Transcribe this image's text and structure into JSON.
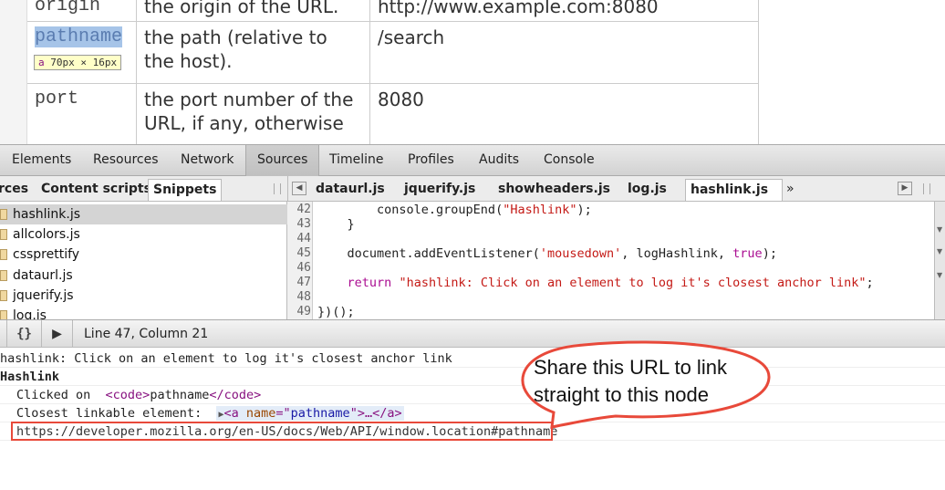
{
  "page": {
    "rows": [
      {
        "name": "origin",
        "desc": "the origin of the URL.",
        "example": "http://www.example.com:8080"
      },
      {
        "name": "pathname",
        "desc": "the path (relative to the host).",
        "example": "/search"
      },
      {
        "name": "port",
        "desc": "the port number of the URL, if any, otherwise",
        "example": "8080"
      }
    ],
    "tooltip": {
      "tag": "a",
      "dims": "70px × 16px"
    }
  },
  "devtools": {
    "tabs": [
      "Elements",
      "Resources",
      "Network",
      "Sources",
      "Timeline",
      "Profiles",
      "Audits",
      "Console"
    ],
    "selected_tab": "Sources",
    "nav_tabs": [
      "rces",
      "Content scripts",
      "Snippets"
    ],
    "files": [
      "hashlink.js",
      "allcolors.js",
      "cssprettify",
      "dataurl.js",
      "jquerify.js",
      "log.js"
    ],
    "editor_tabs": [
      "dataurl.js",
      "jquerify.js",
      "showheaders.js",
      "log.js",
      "hashlink.js"
    ],
    "more_tabs": "»",
    "line_numbers": [
      "42",
      "43",
      "44",
      "45",
      "46",
      "47",
      "48",
      "49"
    ],
    "code": {
      "l42a": "        console.groupEnd(",
      "l42b": "\"Hashlink\"",
      "l42c": ");",
      "l43": "    }",
      "l45a": "    document.addEventListener(",
      "l45b": "'mousedown'",
      "l45c": ", logHashlink, ",
      "l45d": "true",
      "l45e": ");",
      "l47a": "    ",
      "l47b": "return",
      "l47c": " ",
      "l47d": "\"hashlink: Click on an element to log it's closest anchor link\"",
      "l47e": ";",
      "l49": "})();"
    },
    "status": {
      "pretty_print": "{}",
      "position": "Line 47, Column 21"
    },
    "console": {
      "line1": "hashlink: Click on an element to log it's closest anchor link",
      "group": "Hashlink",
      "clicked_label": "Clicked on  ",
      "clicked_open": "<code>",
      "clicked_text": "pathname",
      "clicked_close": "</code>",
      "closest_label": "Closest linkable element:  ",
      "el_open": "<a ",
      "el_attr": "name",
      "el_eq": "=\"",
      "el_val": "pathname",
      "el_end": "\">…</a>",
      "url": "https://developer.mozilla.org/en-US/docs/Web/API/window.location#pathname"
    }
  },
  "callout": {
    "line1": "Share this URL to link",
    "line2": "straight to this node",
    "color": "#e8493a"
  }
}
